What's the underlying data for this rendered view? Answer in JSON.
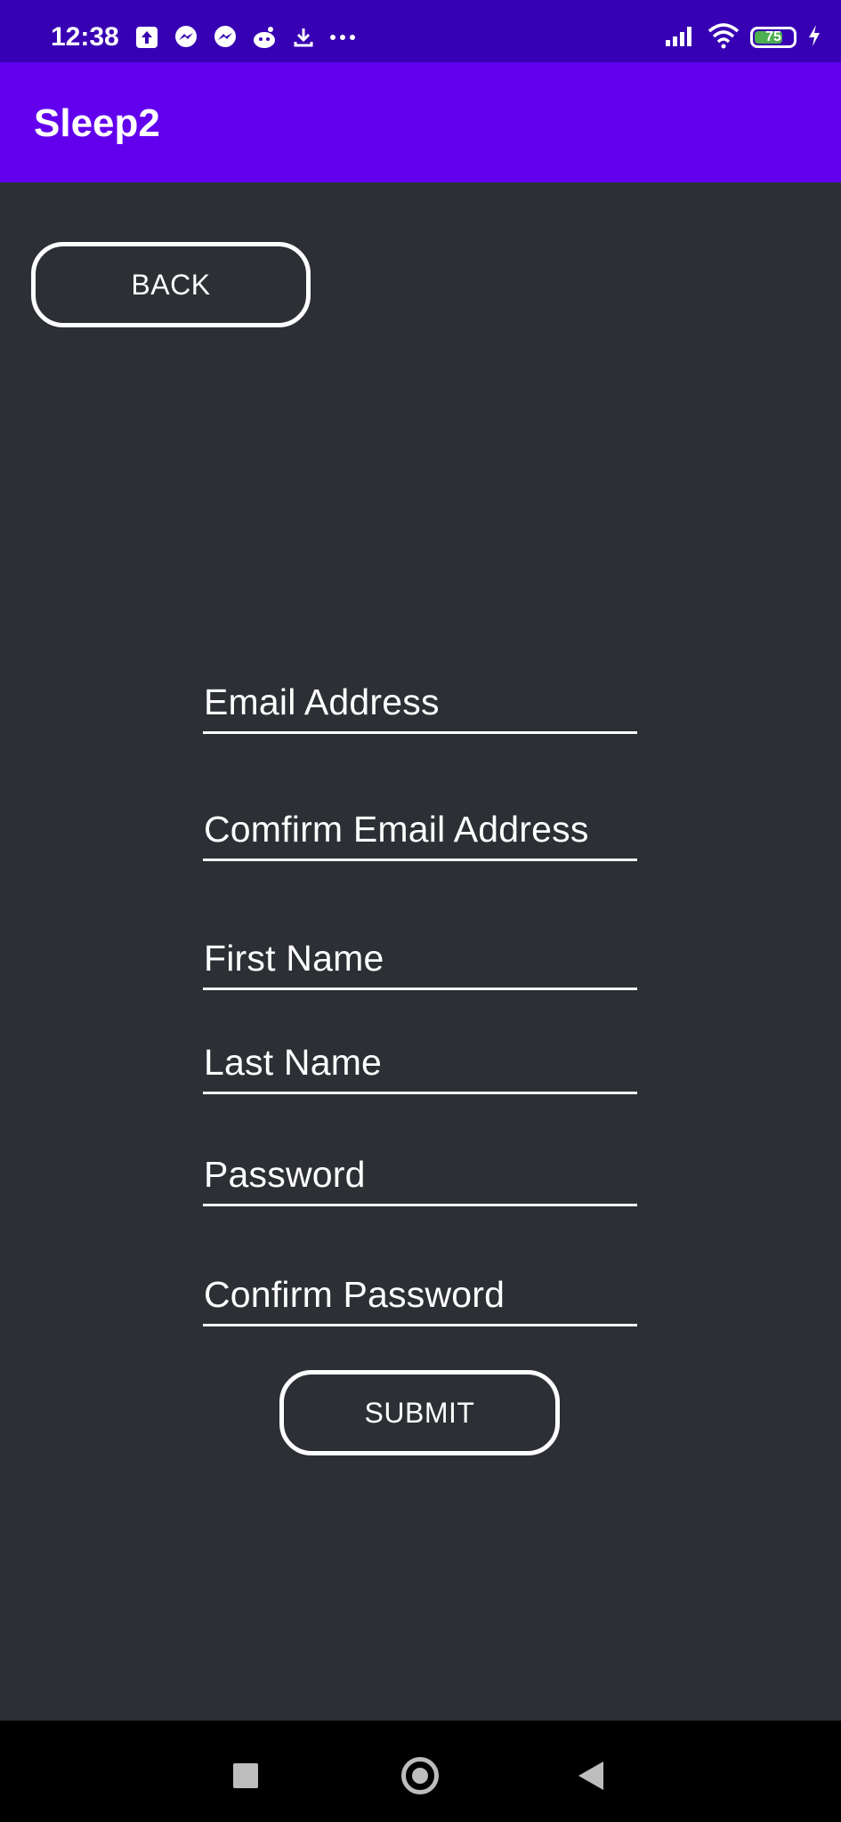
{
  "status_bar": {
    "time": "12:38",
    "left_icons": [
      "upload-icon",
      "messenger-icon",
      "messenger-icon",
      "reddit-icon",
      "download-icon",
      "more-icon"
    ],
    "right_icons": [
      "signal-icon",
      "wifi-icon",
      "battery-icon",
      "charging-icon"
    ],
    "battery_level": "75",
    "battery_fraction": 0.75
  },
  "app_bar": {
    "title": "Sleep2",
    "color": "#6200ee"
  },
  "buttons": {
    "back_label": "BACK",
    "submit_label": "SUBMIT"
  },
  "form": {
    "fields": [
      {
        "label": "Email Address"
      },
      {
        "label": "Comfirm Email Address"
      },
      {
        "label": "First Name"
      },
      {
        "label": "Last Name"
      },
      {
        "label": "Password"
      },
      {
        "label": "Confirm Password"
      }
    ]
  },
  "colors": {
    "status_bar": "#3700b3",
    "app_bar": "#6200ee",
    "background": "#2c2f34",
    "foreground": "#ffffff",
    "nav_bar": "#000000"
  },
  "nav_bar": {
    "icons": [
      "recents-icon",
      "home-icon",
      "back-icon"
    ]
  }
}
